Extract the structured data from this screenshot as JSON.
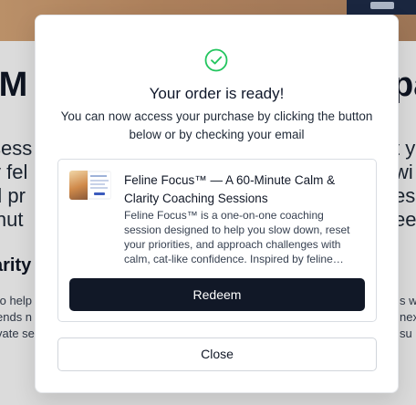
{
  "colors": {
    "success": "#22c55e",
    "primary_button": "#111827",
    "hero_banner": "#c8946a"
  },
  "modal": {
    "icon": "check-circle-icon",
    "title": "Your order is ready!",
    "description": "You can now access your purchase by clicking the button below or by checking your email",
    "product": {
      "thumbnail_icon": "product-thumbnail",
      "name": "Feline Focus™ — A 60-Minute Calm & Clarity Coaching Sessions",
      "description": "Feline Focus™ is a one-on-one coaching session designed to help you slow down, reset your priorities, and approach challenges with calm, cat-like confidence. Inspired by feline…",
      "redeem_label": "Redeem"
    },
    "close_label": "Close"
  }
}
